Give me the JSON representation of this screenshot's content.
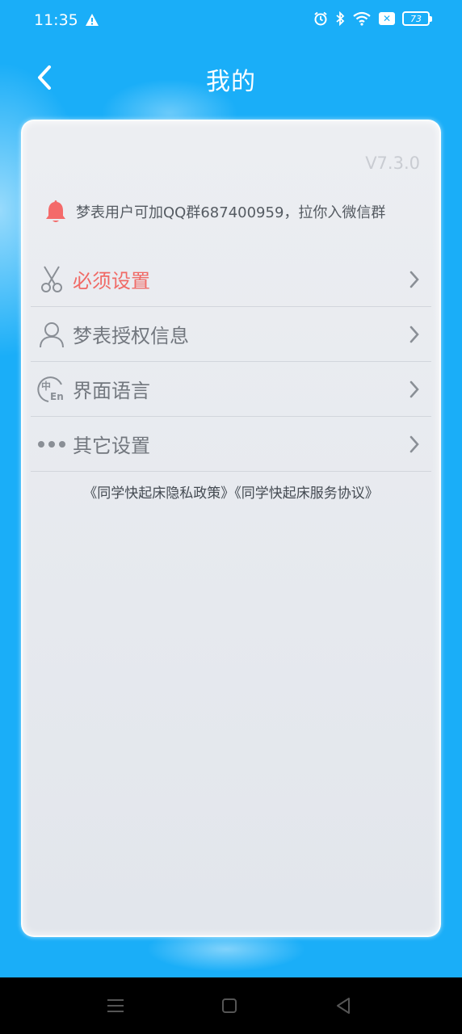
{
  "status_bar": {
    "time": "11:35",
    "battery": "73",
    "notification_badge": "✕"
  },
  "header": {
    "title": "我的"
  },
  "card": {
    "version": "V7.3.0",
    "notice": "梦表用户可加QQ群687400959，拉你入微信群",
    "menu": [
      {
        "label": "必须设置",
        "icon": "scissors-icon",
        "highlight": true
      },
      {
        "label": "梦表授权信息",
        "icon": "user-icon",
        "highlight": false
      },
      {
        "label": "界面语言",
        "icon": "language-icon",
        "highlight": false
      },
      {
        "label": "其它设置",
        "icon": "more-dots-icon",
        "highlight": false
      }
    ],
    "privacy_policy": "《同学快起床隐私政策》",
    "service_agreement": "《同学快起床服务协议》"
  },
  "colors": {
    "background": "#1aaef8",
    "highlight_text": "#f06a66",
    "bell": "#f46a6a"
  }
}
